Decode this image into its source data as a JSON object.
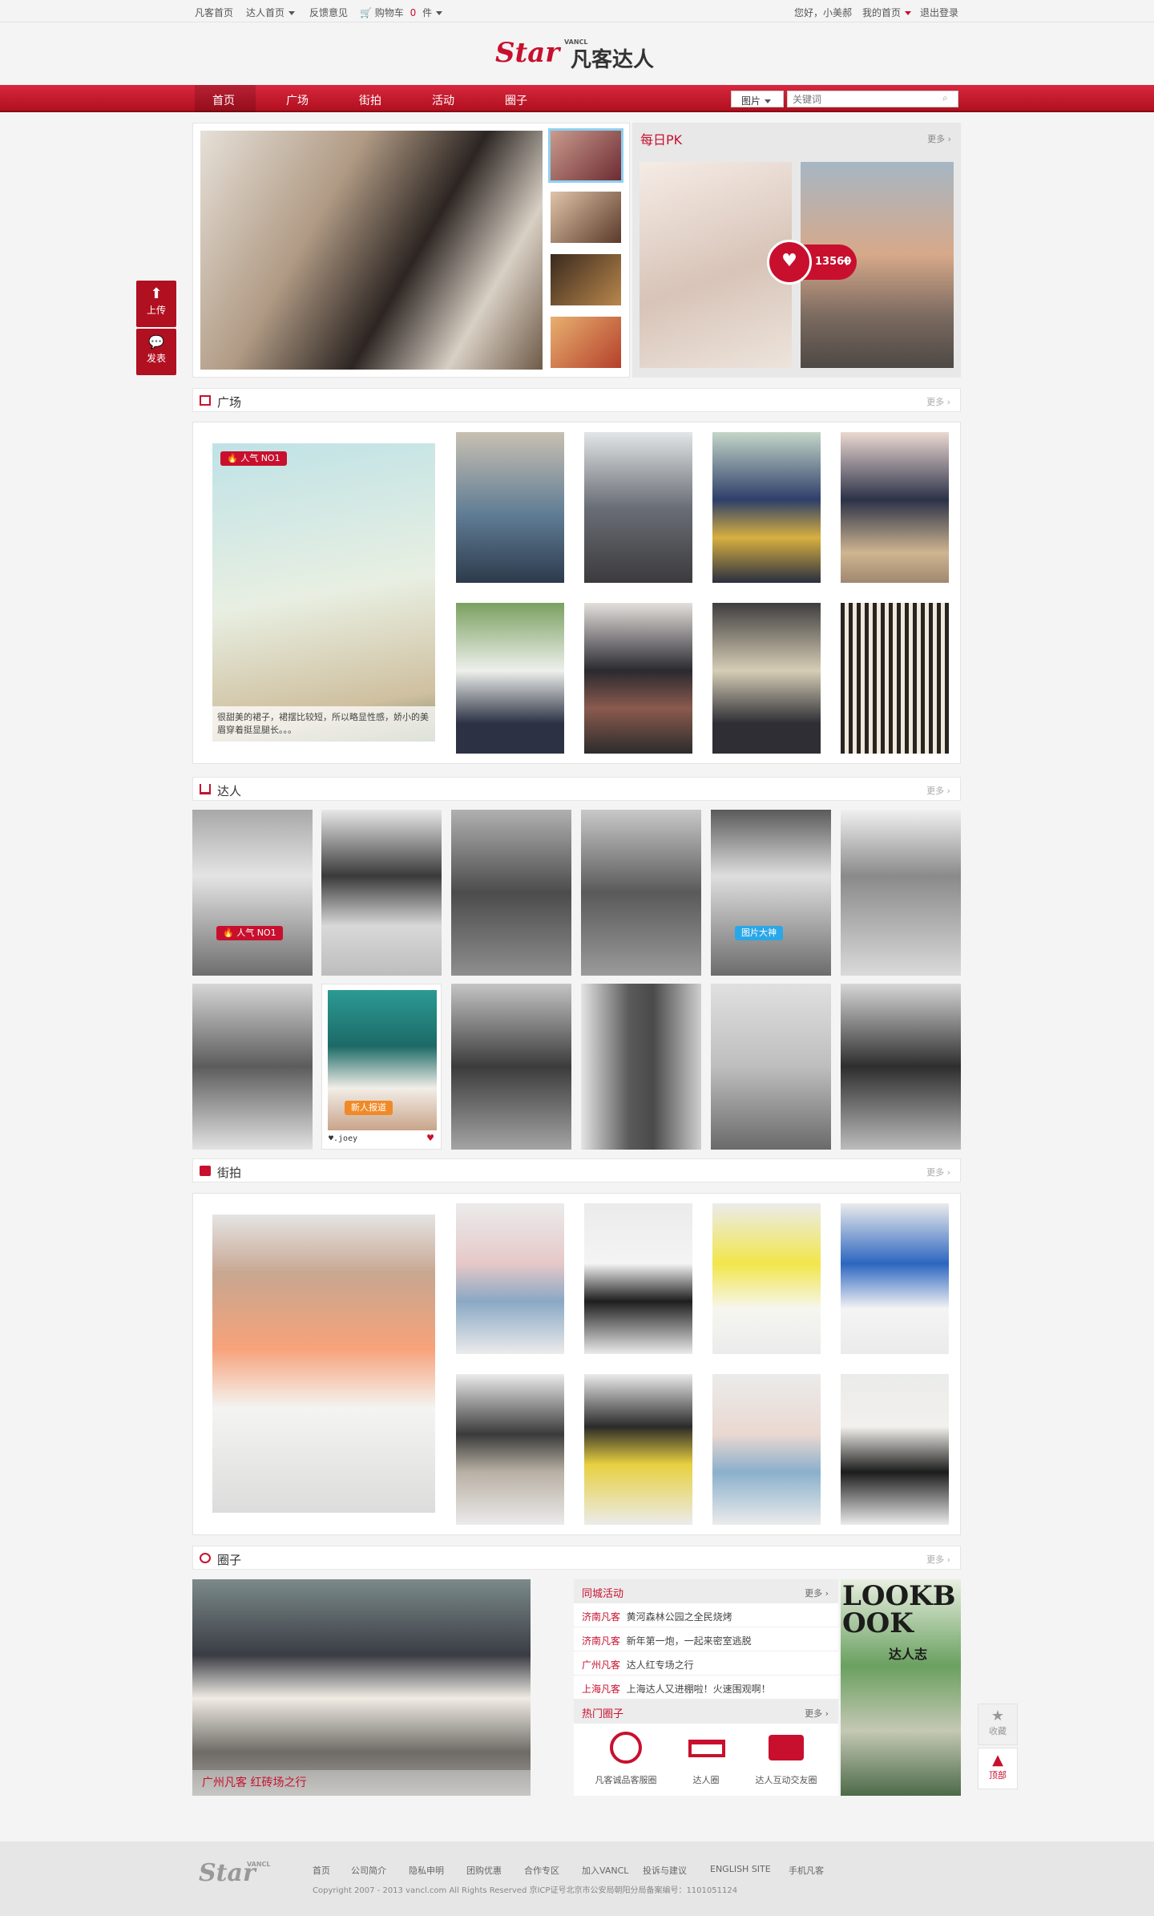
{
  "topbar": {
    "home": "凡客首页",
    "star_home": "达人首页",
    "feedback": "反馈意见",
    "cart": "购物车",
    "cart_count": "0",
    "cart_unit": "件",
    "greeting": "您好，小美郝",
    "my_home": "我的首页",
    "logout": "退出登录"
  },
  "logo": {
    "star": "Star",
    "vancl": "VANCL",
    "name": "凡客达人"
  },
  "nav": {
    "items": [
      "首页",
      "广场",
      "街拍",
      "活动",
      "圈子"
    ],
    "search_type": "图片",
    "search_placeholder": "关键词"
  },
  "sidebar": {
    "upload": "上传",
    "post": "发表"
  },
  "pk": {
    "title": "每日PK",
    "more": "更多",
    "votes": "13560"
  },
  "square": {
    "title": "广场",
    "more": "更多",
    "badge": "人气 NO1",
    "caption": "很甜美的裙子，裙摆比较短，所以略显性感，娇小的美眉穿着挺显腿长。。。"
  },
  "experts": {
    "title": "达人",
    "more": "更多",
    "badge_popular": "人气 NO1",
    "badge_photo": "图片大神",
    "badge_new": "新人报道",
    "new_user": "♥.joey"
  },
  "street": {
    "title": "街拍",
    "more": "更多"
  },
  "circle": {
    "title": "圈子",
    "more": "更多",
    "photo_caption": "广州凡客 红砖场之行",
    "events_title": "同城活动",
    "events_more": "更多",
    "events": [
      {
        "city": "济南凡客",
        "text": "黄河森林公园之全民烧烤"
      },
      {
        "city": "济南凡客",
        "text": "新年第一炮，一起来密室逃脱"
      },
      {
        "city": "广州凡客",
        "text": "达人红专场之行"
      },
      {
        "city": "上海凡客",
        "text": "上海达人又进棚啦！火速围观啊！"
      }
    ],
    "hot_title": "热门圈子",
    "hot_more": "更多",
    "hot": [
      {
        "label": "凡客诚品客服圈",
        "icon": "headset-icon"
      },
      {
        "label": "达人圈",
        "icon": "glasses-icon"
      },
      {
        "label": "达人互动交友圈",
        "icon": "chat-icon"
      }
    ],
    "magazine_title": "LOOKBOOK",
    "magazine_sub": "达人志"
  },
  "float": {
    "favorite": "收藏",
    "top": "顶部"
  },
  "footer": {
    "links": [
      "首页",
      "公司简介",
      "隐私申明",
      "团购优惠",
      "合作专区",
      "加入VANCL",
      "投诉与建议",
      "ENGLISH SITE",
      "手机凡客"
    ],
    "copyright": "Copyright 2007 - 2013 vancl.com All Rights Reserved 京ICP证号北京市公安局朝阳分局备案编号：1101051124"
  },
  "colors": {
    "brand": "#c8102e",
    "nav": "#c41a30"
  }
}
